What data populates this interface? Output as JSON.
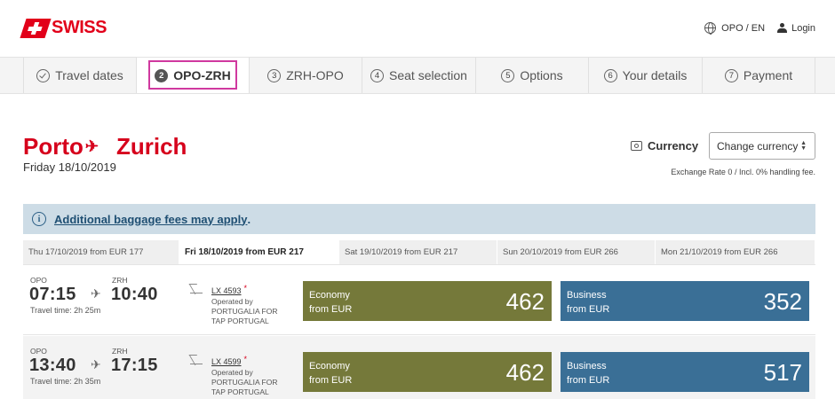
{
  "header": {
    "brand": "SWISS",
    "locale": "OPO / EN",
    "login": "Login"
  },
  "steps": [
    {
      "num": "",
      "label": "Travel dates",
      "state": "done"
    },
    {
      "num": "2",
      "label": "OPO-ZRH",
      "state": "active"
    },
    {
      "num": "3",
      "label": "ZRH-OPO",
      "state": "pending"
    },
    {
      "num": "4",
      "label": "Seat selection",
      "state": "pending"
    },
    {
      "num": "5",
      "label": "Options",
      "state": "pending"
    },
    {
      "num": "6",
      "label": "Your details",
      "state": "pending"
    },
    {
      "num": "7",
      "label": "Payment",
      "state": "pending"
    }
  ],
  "route": {
    "from": "Porto",
    "plane": "✈",
    "to": "Zurich",
    "date": "Friday 18/10/2019"
  },
  "currency": {
    "label": "Currency",
    "select": "Change currency",
    "exchange": "Exchange Rate 0 / Incl. 0% handling fee."
  },
  "banner": {
    "info": "i",
    "text": "Additional baggage fees may apply",
    "suffix": "."
  },
  "date_tabs": [
    {
      "label": "Thu 17/10/2019 from EUR  177",
      "selected": false
    },
    {
      "label": "Fri 18/10/2019 from EUR  217",
      "selected": true
    },
    {
      "label": "Sat 19/10/2019 from EUR  217",
      "selected": false
    },
    {
      "label": "Sun 20/10/2019 from EUR  266",
      "selected": false
    },
    {
      "label": "Mon 21/10/2019 from EUR  266",
      "selected": false
    }
  ],
  "flights": [
    {
      "dep_airport": "OPO",
      "dep_time": "07:15",
      "arr_airport": "ZRH",
      "arr_time": "10:40",
      "travel_time": "Travel time: 2h 25m",
      "flight_no": "LX 4593",
      "star": "*",
      "operated": "Operated by PORTUGALIA FOR TAP PORTUGAL",
      "economy": {
        "label1": "Economy",
        "label2": "from EUR",
        "price": "462"
      },
      "business": {
        "label1": "Business",
        "label2": "from EUR",
        "price": "352"
      }
    },
    {
      "dep_airport": "OPO",
      "dep_time": "13:40",
      "arr_airport": "ZRH",
      "arr_time": "17:15",
      "travel_time": "Travel time: 2h 35m",
      "flight_no": "LX 4599",
      "star": "*",
      "operated": "Operated by PORTUGALIA FOR TAP PORTUGAL",
      "economy": {
        "label1": "Economy",
        "label2": "from EUR",
        "price": "462"
      },
      "business": {
        "label1": "Business",
        "label2": "from EUR",
        "price": "517"
      }
    }
  ],
  "colors": {
    "brand_red": "#e2001a",
    "economy": "#75793a",
    "business": "#3a6f96",
    "banner": "#cddce6",
    "active_outline": "#d0399f"
  }
}
